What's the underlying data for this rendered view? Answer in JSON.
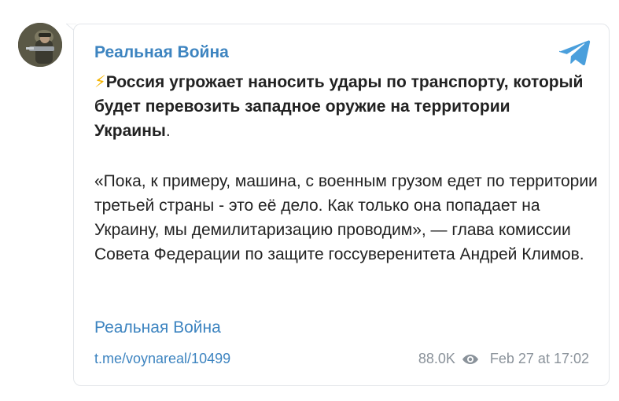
{
  "post": {
    "channel_name": "Реальная Война",
    "headline_icon": "⚡",
    "headline_bold": "Россия угрожает наносить удары по транспорту, который будет перевозить западное оружие на территории Украины",
    "headline_tail": ".",
    "body": "«Пока, к примеру, машина, с военным грузом едет по территории третьей страны - это её дело. Как только она попадает на Украину, мы демилитаризацию проводим», — глава комиссии Совета Федерации по защите госсуверенитета Андрей Климов.",
    "footer_channel_name": "Реальная Война",
    "link": "t.me/voynareal/10499",
    "views": "88.0K",
    "date": "Feb 27 at 17:02"
  },
  "icons": {
    "brand": "telegram-icon",
    "views": "eye-icon",
    "avatar": "avatar"
  },
  "colors": {
    "accent": "#3d84c0",
    "text": "#222222",
    "meta": "#8a929a",
    "telegram": "#4a9fdc"
  }
}
